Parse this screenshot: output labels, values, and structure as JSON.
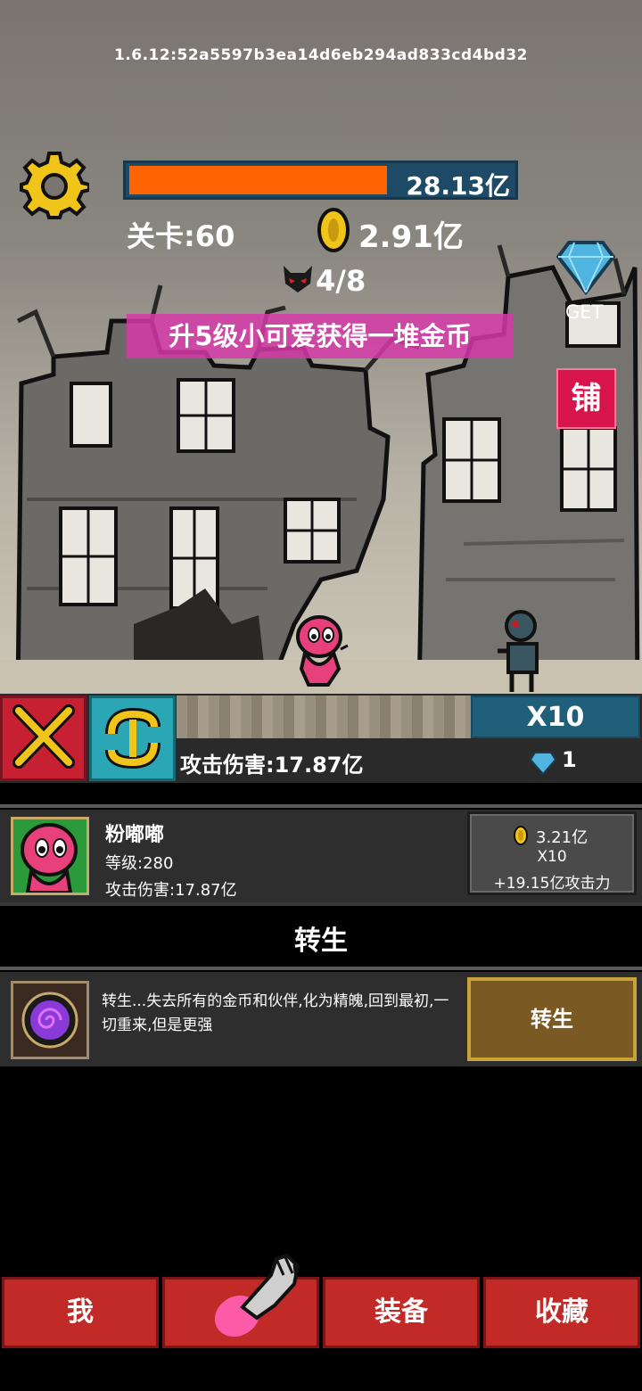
{
  "version": "1.6.12:52a5597b3ea14d6eb294ad833cd4bd32",
  "hp": {
    "value": "28.13亿",
    "fill_fraction": 0.67
  },
  "stage": "关卡:60",
  "gold": "2.91亿",
  "wave": "4/8",
  "gem_get_label": "GET",
  "promo": "升5级小可爱获得一堆金币",
  "shop_label": "铺",
  "action_bar": {
    "multiplier": "X10",
    "attack": "攻击伤害:17.87亿",
    "gems": "1"
  },
  "hero": {
    "name": "粉嘟嘟",
    "level": "等级:280",
    "attack": "攻击伤害:17.87亿",
    "upgrade": {
      "cost": "3.21亿",
      "multiplier": "X10",
      "bonus": "+19.15亿攻击力"
    }
  },
  "rebirth": {
    "title": "转生",
    "description": "转生...失去所有的金币和伙伴,化为精魄,回到最初,一切重来,但是更强",
    "button": "转生"
  },
  "nav": {
    "me": "我",
    "equipment": "装备",
    "collection": "收藏"
  },
  "colors": {
    "hp_fill": "#ff6400",
    "promo": "#d63aa8",
    "nav": "#c22a28",
    "rebirth_btn": "#7a5a22"
  }
}
